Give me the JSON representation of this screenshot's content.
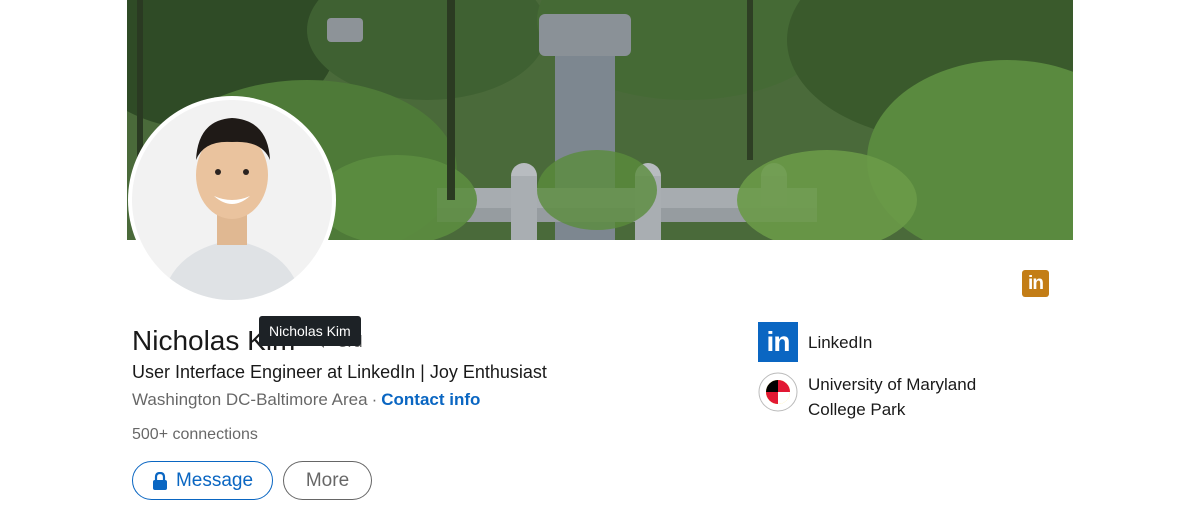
{
  "profile": {
    "name": "Nicholas Kim",
    "degree": "3rd",
    "tooltip": "Nicholas Kim",
    "headline": "User Interface Engineer at LinkedIn | Joy Enthusiast",
    "location": "Washington DC-Baltimore Area",
    "separator": "·",
    "contact_info": "Contact info",
    "connections": "500+ connections"
  },
  "actions": {
    "message": "Message",
    "more": "More"
  },
  "sidebar": {
    "items": [
      {
        "label": "LinkedIn",
        "icon": "linkedin-logo-icon"
      },
      {
        "label": "University of Maryland College Park",
        "icon": "umd-seal-icon"
      }
    ]
  },
  "badge": {
    "text": "in",
    "icon": "premium-badge-icon"
  },
  "logo": {
    "text": "in"
  },
  "colors": {
    "accent": "#0a66c2",
    "premium": "#c37d16",
    "tooltip_bg": "#1d2226"
  }
}
